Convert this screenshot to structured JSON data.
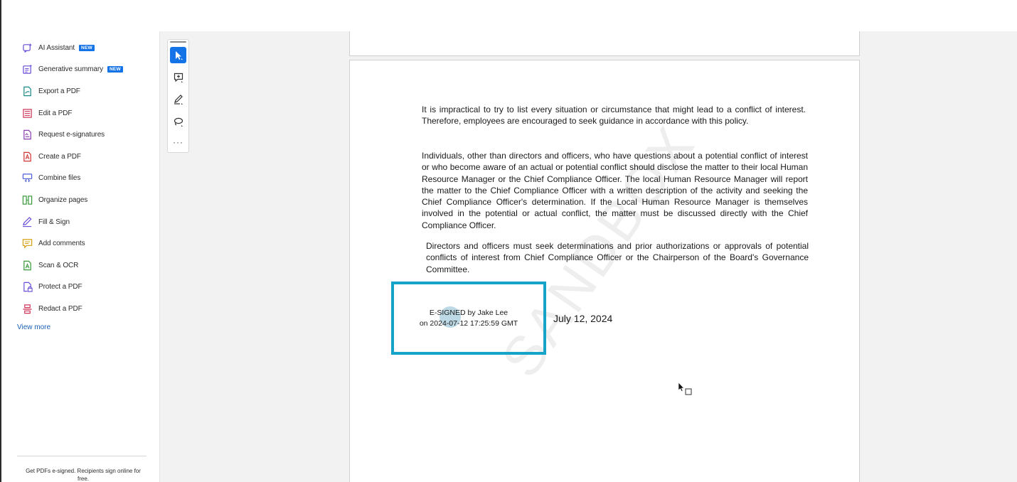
{
  "sidebar": {
    "items": [
      {
        "label": "AI Assistant",
        "badge": "NEW",
        "icon": "ai-assistant-icon",
        "color": "#6b4fd8"
      },
      {
        "label": "Generative summary",
        "badge": "NEW",
        "icon": "generative-summary-icon",
        "color": "#6b4fd8"
      },
      {
        "label": "Export a PDF",
        "badge": "",
        "icon": "export-pdf-icon",
        "color": "#1a8a8a"
      },
      {
        "label": "Edit a PDF",
        "badge": "",
        "icon": "edit-pdf-icon",
        "color": "#d0365a"
      },
      {
        "label": "Request e-signatures",
        "badge": "",
        "icon": "request-esignature-icon",
        "color": "#8a3fb0"
      },
      {
        "label": "Create a PDF",
        "badge": "",
        "icon": "create-pdf-icon",
        "color": "#d03434"
      },
      {
        "label": "Combine files",
        "badge": "",
        "icon": "combine-files-icon",
        "color": "#4f5fd8"
      },
      {
        "label": "Organize pages",
        "badge": "",
        "icon": "organize-pages-icon",
        "color": "#3a9a3a"
      },
      {
        "label": "Fill & Sign",
        "badge": "",
        "icon": "fill-sign-icon",
        "color": "#6b4fd8"
      },
      {
        "label": "Add comments",
        "badge": "",
        "icon": "add-comments-icon",
        "color": "#d4a012"
      },
      {
        "label": "Scan & OCR",
        "badge": "",
        "icon": "scan-ocr-icon",
        "color": "#3a9a3a"
      },
      {
        "label": "Protect a PDF",
        "badge": "",
        "icon": "protect-pdf-icon",
        "color": "#6b4fd8"
      },
      {
        "label": "Redact a PDF",
        "badge": "",
        "icon": "redact-pdf-icon",
        "color": "#d0365a"
      }
    ],
    "view_more": "View more",
    "promo": "Get PDFs e-signed. Recipients sign online for free."
  },
  "toolbar": {
    "tools": [
      {
        "name": "select-tool",
        "icon": "cursor-arrow-icon",
        "active": true
      },
      {
        "name": "add-comment-tool",
        "icon": "comment-plus-icon",
        "active": false
      },
      {
        "name": "highlight-tool",
        "icon": "pen-icon",
        "active": false
      },
      {
        "name": "draw-tool",
        "icon": "lasso-icon",
        "active": false
      }
    ],
    "more": "···"
  },
  "document": {
    "paragraph1": "It is impractical to try to list every situation or circumstance that might lead to a conflict of interest. Therefore, employees are encouraged to seek guidance in accordance with this policy.",
    "paragraph2": "Individuals, other than directors and officers, who have questions about a potential conflict of interest or who become aware of an actual or potential conflict should disclose the matter to their local Human Resource Manager or the Chief Compliance Officer. The local Human Resource Manager will report the matter to the Chief Compliance Officer with a written description of the activity and seeking the Chief Compliance Officer's determination. If the Local Human Resource Manager is themselves involved in the potential or actual conflict, the matter must be discussed directly with the Chief Compliance Officer.",
    "paragraph3": "Directors and officers must seek determinations and prior authorizations or approvals of potential conflicts of interest from Chief Compliance Officer or the Chairperson of the Board's Governance Committee.",
    "signature_line1": "E-SIGNED by Jake Lee",
    "signature_line2": "on 2024-07-12 17:25:59 GMT",
    "signature_date": "July 12, 2024",
    "watermark": "SANDBOX",
    "highlight_color": "#15a4c8"
  },
  "colors": {
    "accent": "#1473e6",
    "link": "#1a5fb4"
  }
}
